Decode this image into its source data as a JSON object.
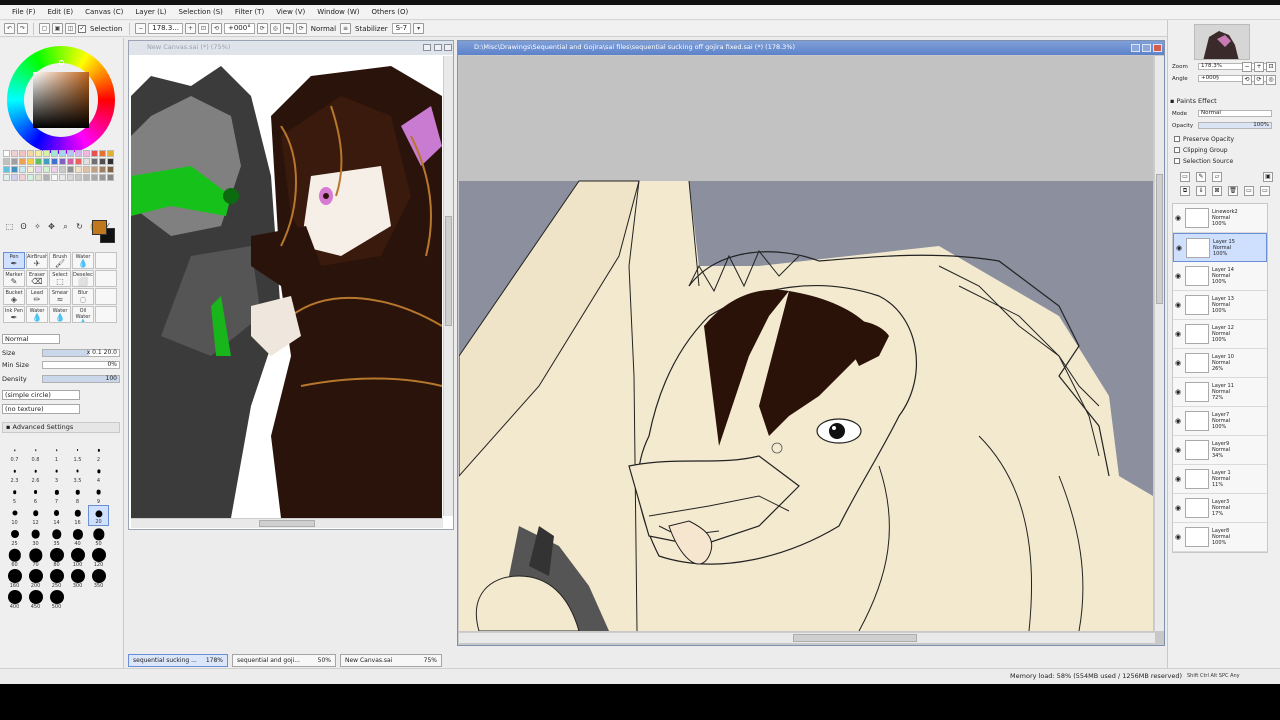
{
  "menu": [
    "File (F)",
    "Edit (E)",
    "Canvas (C)",
    "Layer (L)",
    "Selection (S)",
    "Filter (T)",
    "View (V)",
    "Window (W)",
    "Others (O)"
  ],
  "toolbar": {
    "selection_label": "Selection",
    "zoom_value": "178.3...",
    "angle_value": "+000°",
    "mode_value": "Normal",
    "stabilizer_label": "Stabilizer",
    "stabilizer_value": "S-7"
  },
  "left": {
    "tool_labels": [
      "Pen",
      "AirBrush",
      "Brush",
      "Water",
      "",
      "Marker",
      "Eraser",
      "Select",
      "Deselect",
      "",
      "Bucket",
      "Lead",
      "Smear",
      "Blur",
      "",
      "Ink Pen",
      "Water",
      "Water",
      "Oil Water",
      ""
    ],
    "blend_mode": "Normal",
    "size_label": "Size",
    "size_mult": "x 0.1",
    "size_value": "20.0",
    "min_size_label": "Min Size",
    "min_size_value": "0%",
    "density_label": "Density",
    "density_value": "100",
    "shape": "(simple circle)",
    "texture": "(no texture)",
    "advanced_label": "Advanced Settings",
    "sizes": [
      "0.7",
      "0.8",
      "1",
      "1.5",
      "2",
      "2.3",
      "2.6",
      "3",
      "3.5",
      "4",
      "5",
      "6",
      "7",
      "8",
      "9",
      "10",
      "12",
      "14",
      "16",
      "20",
      "25",
      "30",
      "35",
      "40",
      "50",
      "60",
      "70",
      "80",
      "100",
      "120",
      "160",
      "200",
      "250",
      "300",
      "350",
      "400",
      "450",
      "500"
    ]
  },
  "nav_window": {
    "title": "New Canvas.sai (*) (75%)"
  },
  "main_window": {
    "title": "D:\\Misc\\Drawings\\Sequential and Gojira\\sai files\\sequential sucking off gojira fixed.sai (*) (178.3%)"
  },
  "right": {
    "zoom_label": "Zoom",
    "zoom_value": "178.3%",
    "angle_label": "Angle",
    "angle_value": "+000§",
    "paints_effect": "Paints Effect",
    "mode_label": "Mode",
    "mode_value": "Normal",
    "opacity_label": "Opacity",
    "opacity_value": "100%",
    "preserve_opacity": "Preserve Opacity",
    "clipping_group": "Clipping Group",
    "selection_source": "Selection Source",
    "layers": [
      {
        "name": "Linework2",
        "mode": "Normal",
        "opacity": "100%"
      },
      {
        "name": "Layer 15",
        "mode": "Normal",
        "opacity": "100%"
      },
      {
        "name": "Layer 14",
        "mode": "Normal",
        "opacity": "100%"
      },
      {
        "name": "Layer 13",
        "mode": "Normal",
        "opacity": "100%"
      },
      {
        "name": "Layer 12",
        "mode": "Normal",
        "opacity": "100%"
      },
      {
        "name": "Layer 10",
        "mode": "Normal",
        "opacity": "26%"
      },
      {
        "name": "Layer 11",
        "mode": "Normal",
        "opacity": "72%"
      },
      {
        "name": "Layer7",
        "mode": "Normal",
        "opacity": "100%"
      },
      {
        "name": "Layer9",
        "mode": "Normal",
        "opacity": "34%"
      },
      {
        "name": "Layer 1",
        "mode": "Normal",
        "opacity": "11%"
      },
      {
        "name": "Layer3",
        "mode": "Normal",
        "opacity": "17%"
      },
      {
        "name": "Layer8",
        "mode": "Normal",
        "opacity": "100%"
      }
    ]
  },
  "tabs": [
    {
      "name": "sequential sucking ...",
      "zoom": "178%"
    },
    {
      "name": "sequential and goji...",
      "zoom": "50%"
    },
    {
      "name": "New Canvas.sai",
      "zoom": "75%"
    }
  ],
  "status": {
    "memory": "Memory load: 58% (554MB used / 1256MB reserved)"
  },
  "tray_text": "Shift Ctrl Alt SPC Any"
}
